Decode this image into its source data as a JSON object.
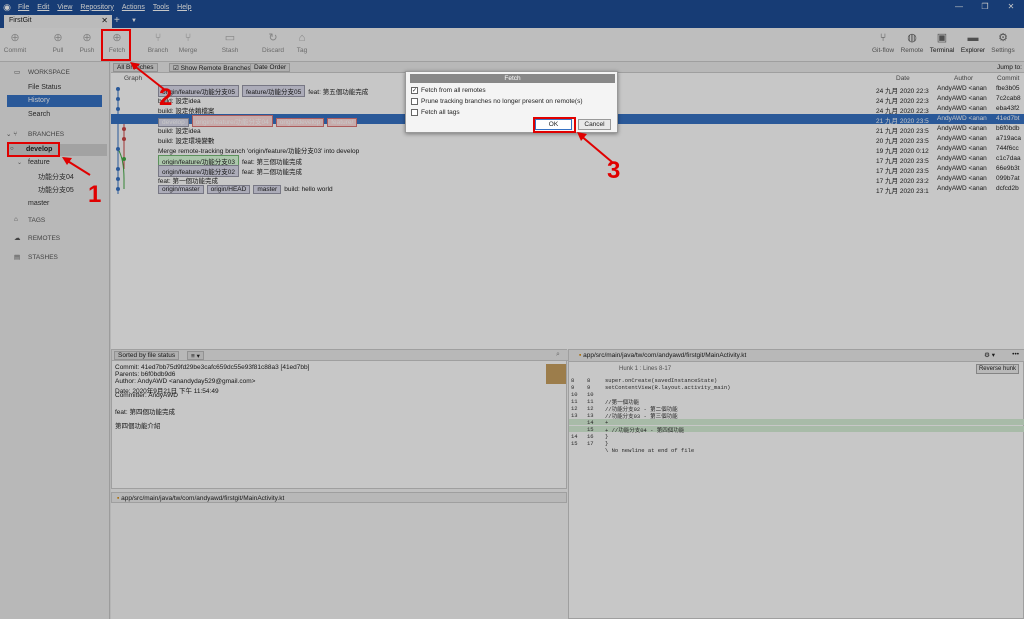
{
  "app": {
    "title": "FirstGit"
  },
  "menu": [
    "File",
    "Edit",
    "View",
    "Repository",
    "Actions",
    "Tools",
    "Help"
  ],
  "window_controls": {
    "minimize": "—",
    "maximize": "❐",
    "close": "✕"
  },
  "toolbar": {
    "commit": "Commit",
    "pull": "Pull",
    "push": "Push",
    "fetch": "Fetch",
    "branch": "Branch",
    "merge": "Merge",
    "stash": "Stash",
    "discard": "Discard",
    "tag": "Tag",
    "gitflow": "Git-flow",
    "remote": "Remote",
    "terminal": "Terminal",
    "explorer": "Explorer",
    "settings": "Settings"
  },
  "sidebar": {
    "workspace": "WORKSPACE",
    "file_status": "File Status",
    "history": "History",
    "search": "Search",
    "branches": "BRANCHES",
    "develop": "develop",
    "feature": "feature",
    "fb04": "功能分支04",
    "fb05": "功能分支05",
    "master": "master",
    "tags": "TAGS",
    "remotes": "REMOTES",
    "stashes": "STASHES"
  },
  "filter": {
    "all_branches": "All Branches",
    "show_remote": "Show Remote Branches",
    "date_order": "Date Order",
    "jump_to": "Jump to:"
  },
  "columns": {
    "graph": "Graph",
    "date": "Date",
    "author": "Author",
    "commit": "Commit"
  },
  "commits": [
    {
      "labels": [
        "origin/feature/功能分支05",
        "feature/功能分支05"
      ],
      "msg": "feat: 第五個功能完成",
      "date": "24 九月 2020 22:3",
      "author": "AndyAWD <anan",
      "hash": "fbe3b05"
    },
    {
      "labels": [],
      "msg": "build: 設定idea",
      "date": "24 九月 2020 22:3",
      "author": "AndyAWD <anan",
      "hash": "7c2cab8"
    },
    {
      "labels": [],
      "msg": "build: 設定依賴檔案",
      "date": "24 九月 2020 22:3",
      "author": "AndyAWD <anan",
      "hash": "eba43f2"
    },
    {
      "labels": [
        "develop",
        "origin/feature/功能分支04",
        "origin/develop",
        "feature/"
      ],
      "msg": "",
      "date": "21 九月 2020 23:5",
      "author": "AndyAWD <anan",
      "hash": "41ed7bt"
    },
    {
      "labels": [],
      "msg": "build: 設定idea",
      "date": "21 九月 2020 23:5",
      "author": "AndyAWD <anan",
      "hash": "b6f0bdb"
    },
    {
      "labels": [],
      "msg": "build: 設定環境變數",
      "date": "20 九月 2020 23:5",
      "author": "AndyAWD <anan",
      "hash": "a719aca"
    },
    {
      "labels": [],
      "msg": "Merge remote-tracking branch 'origin/feature/功能分支03' into develop",
      "date": "19 九月 2020 0:12",
      "author": "AndyAWD <anan",
      "hash": "744f6cc"
    },
    {
      "labels": [
        "origin/feature/功能分支03"
      ],
      "msg": "feat: 第三個功能完成",
      "date": "17 九月 2020 23:5",
      "author": "AndyAWD <anan",
      "hash": "c1c7daa"
    },
    {
      "labels": [
        "origin/feature/功能分支02"
      ],
      "msg": "feat: 第二個功能完成",
      "date": "17 九月 2020 23:5",
      "author": "AndyAWD <anan",
      "hash": "66e9b3t"
    },
    {
      "labels": [],
      "msg": "feat: 第一個功能完成",
      "date": "17 九月 2020 23:2",
      "author": "AndyAWD <anan",
      "hash": "099b7at"
    },
    {
      "labels": [
        "origin/master",
        "origin/HEAD",
        "master"
      ],
      "msg": "build: hello world",
      "date": "17 九月 2020 23:1",
      "author": "AndyAWD <anan",
      "hash": "dcfcd2b"
    }
  ],
  "commit_detail": {
    "sort": "Sorted by file status",
    "commit_line": "Commit: 41ed7bb75d9fd29be3cafc659dc55e93f81c88a3 [41ed7bb]",
    "parents": "Parents: b6f0bdb9d6",
    "author": "Author: AndyAWD <anandyday529@gmail.com>",
    "date": "Date: 2020年9月21日 下午 11:54:49",
    "committer": "Committer: AndyAWD",
    "msg1": "feat: 第四個功能完成",
    "msg2": "第四個功能介紹",
    "file_path": "app/src/main/java/tw/com/andyawd/firstgit/MainActivity.kt"
  },
  "diff": {
    "path": "app/src/main/java/tw/com/andyawd/firstgit/MainActivity.kt",
    "hunk": "Hunk 1 : Lines 8-17",
    "reverse": "Reverse hunk",
    "lines": [
      {
        "a": "8",
        "b": "8",
        "t": "        super.onCreate(savedInstanceState)",
        "add": false
      },
      {
        "a": "9",
        "b": "9",
        "t": "        setContentView(R.layout.activity_main)",
        "add": false
      },
      {
        "a": "10",
        "b": "10",
        "t": "",
        "add": false
      },
      {
        "a": "11",
        "b": "11",
        "t": "        //第一個功能",
        "add": false
      },
      {
        "a": "12",
        "b": "12",
        "t": "        //功能分支02 - 第二個功能",
        "add": false
      },
      {
        "a": "13",
        "b": "13",
        "t": "        //功能分支03 - 第三個功能",
        "add": false
      },
      {
        "a": "",
        "b": "14",
        "t": "+",
        "add": true
      },
      {
        "a": "",
        "b": "15",
        "t": "+        //功能分支04 - 第四個功能",
        "add": true
      },
      {
        "a": "14",
        "b": "16",
        "t": "    }",
        "add": false
      },
      {
        "a": "15",
        "b": "17",
        "t": "}",
        "add": false
      },
      {
        "a": "",
        "b": "",
        "t": "\\ No newline at end of file",
        "add": false
      }
    ]
  },
  "dialog": {
    "title": "Fetch",
    "opt1": "Fetch from all remotes",
    "opt2": "Prune tracking branches no longer present on remote(s)",
    "opt3": "Fetch all tags",
    "ok": "OK",
    "cancel": "Cancel"
  },
  "annotations": {
    "n1": "1",
    "n2": "2",
    "n3": "3"
  },
  "colors": {
    "accent": "#3672c4",
    "titlebar": "#1e4e96",
    "highlight": "#e00000"
  }
}
